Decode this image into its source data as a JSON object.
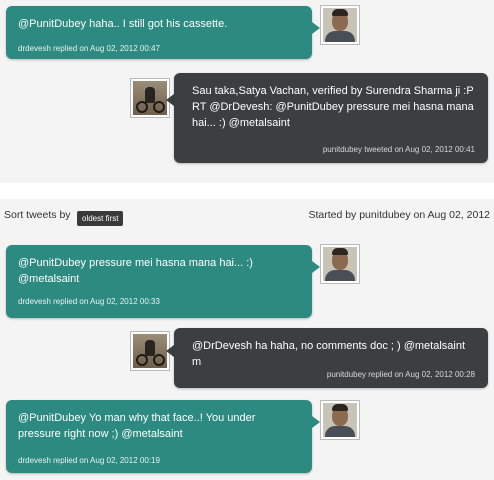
{
  "sort": {
    "label": "Sort tweets by",
    "button": "oldest first"
  },
  "started": "Started by punitdubey on Aug 02, 2012",
  "tweets_top": [
    {
      "text": "@PunitDubey haha.. I still got his cassette.",
      "meta": "drdevesh replied on Aug 02, 2012 00:47"
    },
    {
      "text": "Sau taka,Satya Vachan, verified by Surendra Sharma ji :P RT @DrDevesh: @PunitDubey pressure mei hasna mana hai... :) @metalsaint",
      "meta": "punitdubey tweeted on Aug 02, 2012 00:41"
    }
  ],
  "tweets_bottom": [
    {
      "text": "@PunitDubey pressure mei hasna mana hai... :) @metalsaint",
      "meta": "drdevesh replied on Aug 02, 2012 00:33"
    },
    {
      "text": "@DrDevesh ha haha, no comments doc ; ) @metalsaint m",
      "meta": "punitdubey replied on Aug 02, 2012 00:28"
    },
    {
      "text": "@PunitDubey Yo man why that face..! You under pressure right now ;) @metalsaint",
      "meta": "drdevesh replied on Aug 02, 2012 00:19"
    }
  ],
  "colors": {
    "green_bubble": "#2c8a80",
    "dark_bubble": "#3c3f41"
  },
  "icons": {
    "drdevesh_avatar": "portrait-avatar",
    "punitdubey_avatar": "motorbike-avatar"
  }
}
